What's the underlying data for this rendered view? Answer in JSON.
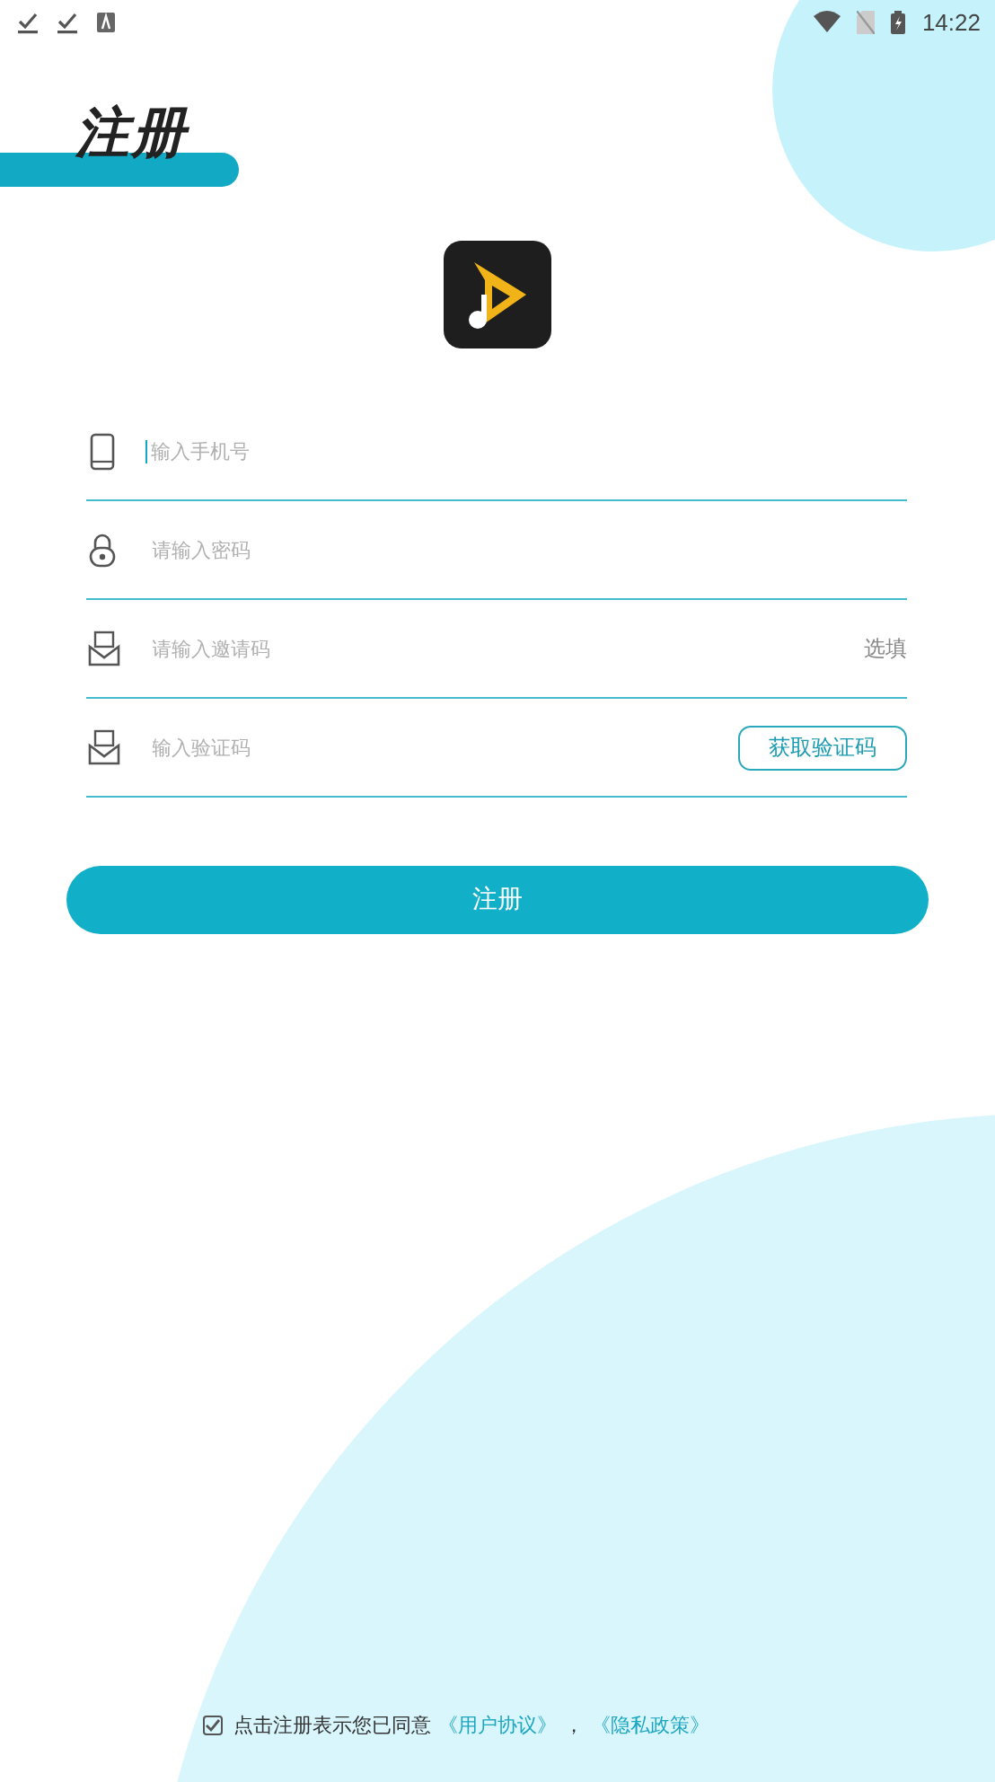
{
  "status_bar": {
    "time": "14:22"
  },
  "title": "注册",
  "fields": [
    {
      "kind": "phone",
      "placeholder": "输入手机号",
      "focused": true
    },
    {
      "kind": "password",
      "placeholder": "请输入密码",
      "focused": false
    },
    {
      "kind": "invite",
      "placeholder": "请输入邀请码",
      "focused": false,
      "suffix": "选填"
    },
    {
      "kind": "code",
      "placeholder": "输入验证码",
      "focused": false,
      "action": "获取验证码"
    }
  ],
  "submit": "注册",
  "agreement": {
    "checked": true,
    "text": "点击注册表示您已同意",
    "links": [
      "《用户协议》",
      "《隐私政策》"
    ],
    "separator": "，"
  }
}
